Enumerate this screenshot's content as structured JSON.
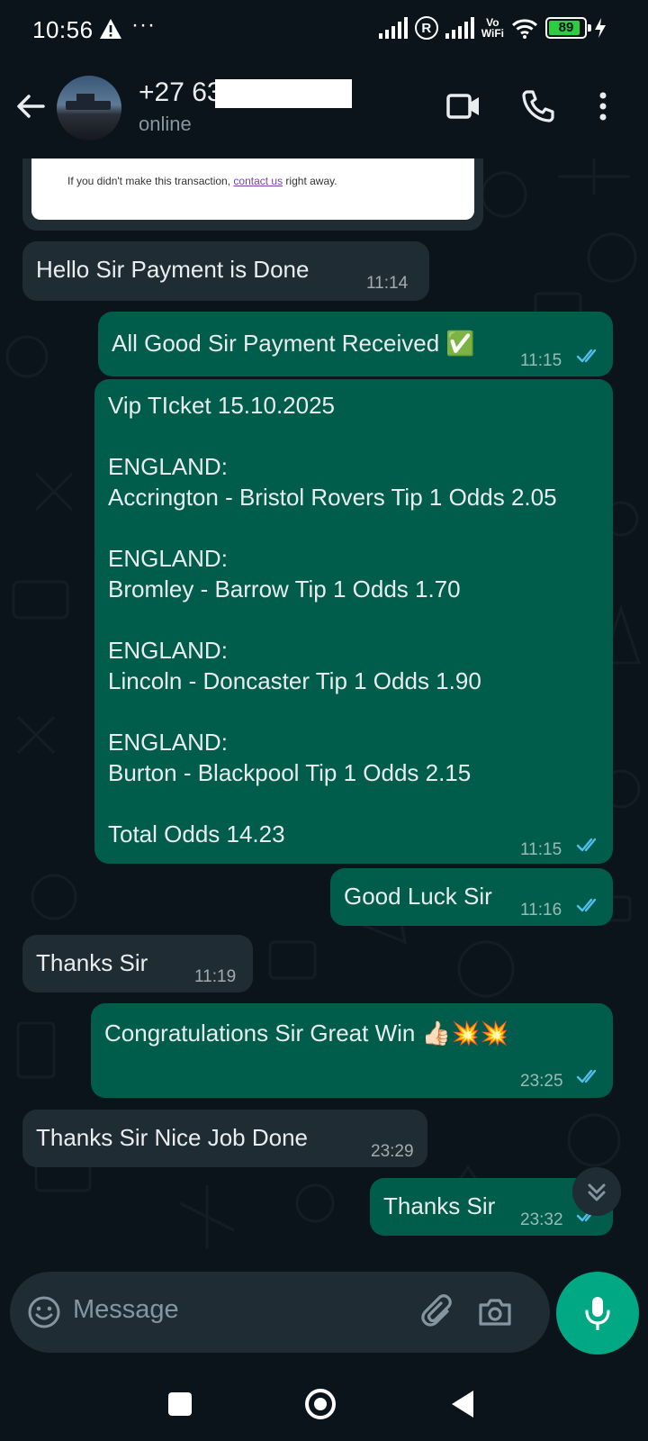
{
  "status_bar": {
    "time": "10:56",
    "more": "···",
    "battery": "89",
    "network": "Vo WiFi"
  },
  "header": {
    "contact_name": "+27 63",
    "contact_status": "online"
  },
  "receipt": {
    "text_before": "If you didn't make this transaction, ",
    "link": "contact us",
    "text_after": " right away."
  },
  "messages": [
    {
      "direction": "in",
      "text": "Hello Sir Payment is Done",
      "time": "11:14"
    },
    {
      "direction": "out",
      "text": "All Good Sir Payment Received ✅",
      "time": "11:15",
      "read": true
    },
    {
      "direction": "out",
      "time": "11:15",
      "read": true,
      "lines": [
        "Vip TIcket 15.10.2025",
        "",
        "ENGLAND:",
        "Accrington - Bristol Rovers Tip 1 Odds 2.05",
        "",
        "ENGLAND:",
        "Bromley - Barrow Tip 1 Odds 1.70",
        "",
        "ENGLAND:",
        "Lincoln - Doncaster Tip 1 Odds 1.90",
        "",
        "ENGLAND:",
        "Burton - Blackpool Tip 1 Odds 2.15",
        "",
        "Total Odds 14.23"
      ]
    },
    {
      "direction": "out",
      "text": "Good Luck Sir",
      "time": "11:16",
      "read": true
    },
    {
      "direction": "in",
      "text": "Thanks Sir",
      "time": "11:19"
    },
    {
      "direction": "out",
      "text": "Congratulations Sir Great Win 👍🏻💥💥",
      "time": "23:25",
      "read": true
    },
    {
      "direction": "in",
      "text": "Thanks Sir Nice Job Done",
      "time": "23:29"
    },
    {
      "direction": "out",
      "text": "Thanks Sir",
      "time": "23:32",
      "read": true
    }
  ],
  "composer": {
    "placeholder": "Message"
  },
  "colors": {
    "background": "#0b141a",
    "incoming_bubble": "#202c33",
    "outgoing_bubble": "#005c4b",
    "accent": "#00a884",
    "read_ticks": "#53bdeb"
  },
  "icons": [
    "back-arrow-icon",
    "video-call-icon",
    "phone-icon",
    "more-vert-icon",
    "emoji-icon",
    "attach-icon",
    "camera-icon",
    "mic-icon",
    "scroll-down-icon",
    "nav-recents-icon",
    "nav-home-icon",
    "nav-back-icon"
  ]
}
